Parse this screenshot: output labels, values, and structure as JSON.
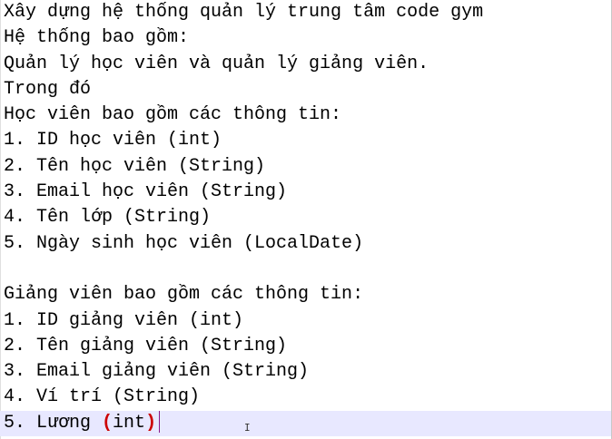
{
  "lines": [
    "Xây dựng hệ thống quản lý trung tâm code gym",
    "Hệ thống bao gồm:",
    "Quản lý học viên và quản lý giảng viên.",
    "Trong đó",
    "Học viên bao gồm các thông tin:",
    "1. ID học viên (int)",
    "2. Tên học viên (String)",
    "3. Email học viên (String)",
    "4. Tên lớp (String)",
    "5. Ngày sinh học viên (LocalDate)",
    "",
    "Giảng viên bao gồm các thông tin:",
    "1. ID giảng viên (int)",
    "2. Tên giảng viên (String)",
    "3. Email giảng viên (String)",
    "4. Ví trí (String)"
  ],
  "current_line": {
    "prefix": "5. Lương ",
    "paren_open": "(",
    "word": "int",
    "paren_close": ")"
  },
  "colors": {
    "text": "#000000",
    "bracket_highlight": "#cc0000",
    "current_line_bg": "#e8e8ff",
    "caret": "#8a1a8a"
  }
}
